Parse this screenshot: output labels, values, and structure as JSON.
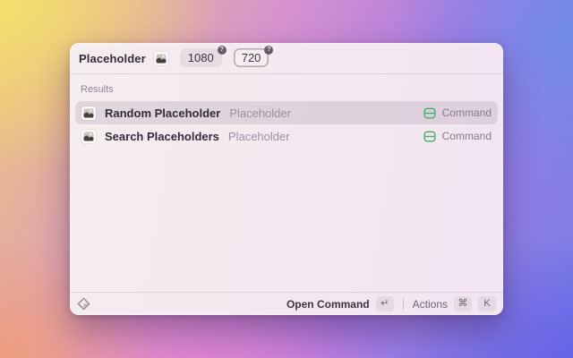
{
  "window": {
    "header": {
      "title": "Placeholder",
      "command_icon": "placeholder-image-icon",
      "args": [
        {
          "value": "1080",
          "badge": "?",
          "focused": false
        },
        {
          "value": "720",
          "badge": "?",
          "focused": true
        }
      ]
    },
    "results": {
      "section_label": "Results",
      "items": [
        {
          "icon": "placeholder-image-icon",
          "title": "Random Placeholder",
          "subtitle": "Placeholder",
          "accessory_icon": "command-type-icon",
          "accessory_label": "Command",
          "selected": true
        },
        {
          "icon": "placeholder-image-icon",
          "title": "Search Placeholders",
          "subtitle": "Placeholder",
          "accessory_icon": "command-type-icon",
          "accessory_label": "Command",
          "selected": false
        }
      ]
    },
    "footer": {
      "left_icon": "extension-diamond-icon",
      "primary_action": {
        "label": "Open Command",
        "key": "↵"
      },
      "secondary_action": {
        "label": "Actions",
        "keys": [
          "⌘",
          "K"
        ]
      }
    }
  },
  "colors": {
    "accent_green": "#4fb175",
    "window_bg": "#f3e9f0",
    "selected_row": "rgba(118,95,118,0.16)",
    "text_primary": "#332d39",
    "text_secondary": "#99919d"
  }
}
